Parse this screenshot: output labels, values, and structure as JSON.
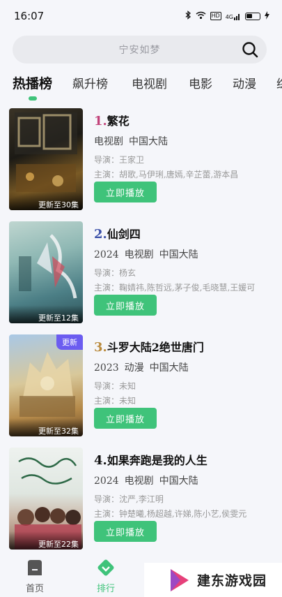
{
  "status": {
    "time": "16:07",
    "signal_label": "4G",
    "hd_label": "HD"
  },
  "search": {
    "placeholder": "宁安如梦"
  },
  "tabs": [
    {
      "label": "热播榜",
      "active": true
    },
    {
      "label": "飙升榜"
    },
    {
      "label": "电视剧"
    },
    {
      "label": "电影"
    },
    {
      "label": "动漫"
    },
    {
      "label": "综"
    }
  ],
  "items": [
    {
      "rank": "1.",
      "rank_color": "#c2437a",
      "title": "繁花",
      "year": "",
      "genre": "电视剧",
      "region": "中国大陆",
      "director": "导演：王家卫",
      "cast": "主演：胡歌,马伊琍,唐嫣,辛芷蕾,游本昌",
      "update": "更新至30集",
      "badge": "",
      "play": "立即播放"
    },
    {
      "rank": "2.",
      "rank_color": "#3a4fa8",
      "title": "仙剑四",
      "year": "2024",
      "genre": "电视剧",
      "region": "中国大陆",
      "director": "导演：杨玄",
      "cast": "主演：鞠婧祎,陈哲远,茅子俊,毛晓慧,王媛可",
      "update": "更新至12集",
      "badge": "",
      "play": "立即播放"
    },
    {
      "rank": "3.",
      "rank_color": "#b98a3c",
      "title": "斗罗大陆2绝世唐门",
      "year": "2023",
      "genre": "动漫",
      "region": "中国大陆",
      "director": "导演：未知",
      "cast": "主演：未知",
      "update": "更新至32集",
      "badge": "更新",
      "play": "立即播放"
    },
    {
      "rank": "4.",
      "rank_color": "#111111",
      "title": "如果奔跑是我的人生",
      "year": "2024",
      "genre": "电视剧",
      "region": "中国大陆",
      "director": "导演：沈严,李江明",
      "cast": "主演：钟楚曦,杨超越,许娣,陈小艺,侯雯元",
      "update": "更新至22集",
      "badge": "",
      "play": "立即播放"
    }
  ],
  "nav": [
    {
      "label": "首页",
      "icon": "home-icon"
    },
    {
      "label": "排行",
      "icon": "rank-icon",
      "active": true
    }
  ],
  "watermark": {
    "text": "建东游戏园"
  },
  "colors": {
    "accent": "#3fc37a",
    "badge": "#6b5cf0"
  }
}
